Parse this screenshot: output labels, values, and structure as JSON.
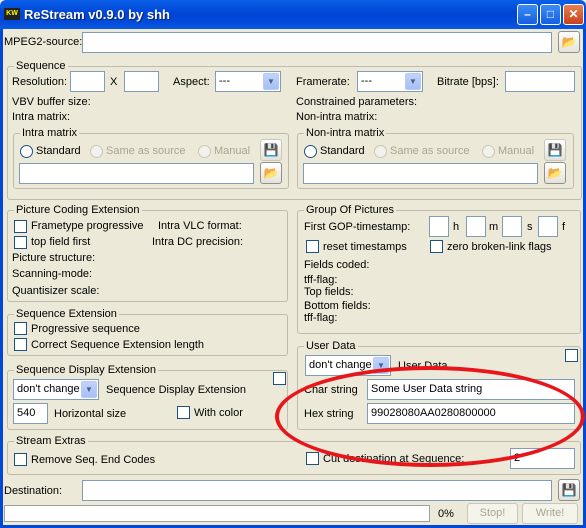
{
  "window": {
    "title": "ReStream v0.9.0 by shh",
    "app_icon_text": "KW",
    "min_glyph": "–",
    "max_glyph": "□",
    "close_glyph": "✕"
  },
  "source": {
    "label": "MPEG2-source:",
    "value": ""
  },
  "sequence": {
    "legend": "Sequence",
    "resolution_label": "Resolution:",
    "width": "",
    "x": "X",
    "height": "",
    "aspect_label": "Aspect:",
    "aspect_value": "---",
    "framerate_label": "Framerate:",
    "framerate_value": "---",
    "bitrate_label": "Bitrate [bps]:",
    "bitrate_value": "",
    "vbv_label": "VBV buffer size:",
    "constrained_label": "Constrained parameters:",
    "intra_label": "Intra matrix:",
    "nonintra_label": "Non-intra matrix:",
    "intra_group": {
      "legend": "Intra matrix",
      "opt_standard": "Standard",
      "opt_same": "Same as source",
      "opt_manual": "Manual"
    },
    "nonintra_group": {
      "legend": "Non-intra matrix",
      "opt_standard": "Standard",
      "opt_same": "Same as source",
      "opt_manual": "Manual"
    }
  },
  "pce": {
    "legend": "Picture Coding Extension",
    "frametype": "Frametype progressive",
    "topfield": "top field first",
    "intra_vlc": "Intra VLC format:",
    "intra_dc": "Intra DC precision:",
    "pic_struct": "Picture structure:",
    "scanning": "Scanning-mode:",
    "quantizer": "Quantisizer scale:"
  },
  "gop": {
    "legend": "Group Of Pictures",
    "first_ts": "First GOP-timestamp:",
    "h": "h",
    "m": "m",
    "s": "s",
    "f": "f",
    "reset": "reset timestamps",
    "zero": "zero broken-link flags",
    "fields_coded": "Fields coded:",
    "tff": "tff-flag:",
    "top_fields": "Top fields:",
    "bottom_fields": "Bottom fields:",
    "tff2": "tff-flag:"
  },
  "seq_ext": {
    "legend": "Sequence Extension",
    "progressive": "Progressive sequence",
    "correct": "Correct Sequence Extension length"
  },
  "seq_disp": {
    "legend": "Sequence Display Extension",
    "mode": "don't change",
    "label": "Sequence Display Extension",
    "hsize": "540",
    "hsize_label": "Horizontal size",
    "with_color": "With color"
  },
  "user_data": {
    "legend": "User Data",
    "mode": "don't change",
    "label": "User Data",
    "char_label": "Char string",
    "char_value": "Some User Data string",
    "hex_label": "Hex string",
    "hex_value": "99028080AA0280800000"
  },
  "extras": {
    "legend": "Stream Extras",
    "remove": "Remove Seq. End Codes",
    "cut": "Cut destination at Sequence:",
    "cut_value": "2"
  },
  "destination": {
    "label": "Destination:",
    "value": ""
  },
  "progress": {
    "percent": "0%",
    "fraction": 0
  },
  "buttons": {
    "stop": "Stop!",
    "write": "Write!"
  },
  "icons": {
    "folder": "📂",
    "save": "💾"
  },
  "colors": {
    "title_bar": "#0048D8",
    "face": "#ECE9D8",
    "annotation": "#E8161A"
  }
}
